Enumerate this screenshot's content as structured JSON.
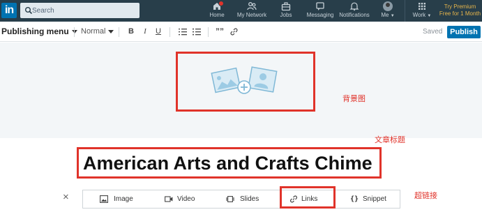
{
  "nav": {
    "logo": "in",
    "search_placeholder": "Search",
    "items": [
      {
        "label": "Home"
      },
      {
        "label": "My Network"
      },
      {
        "label": "Jobs"
      },
      {
        "label": "Messaging"
      },
      {
        "label": "Notifications"
      },
      {
        "label": "Me"
      },
      {
        "label": "Work"
      }
    ],
    "premium_line1": "Try Premium",
    "premium_line2": "Free for 1 Month"
  },
  "toolbar": {
    "publishing_menu": "Publishing menu",
    "style": "Normal",
    "bold": "B",
    "italic": "I",
    "underline": "U",
    "quote": "””",
    "saved": "Saved",
    "publish": "Publish"
  },
  "annotations": {
    "cover": "背景图",
    "title": "文章标题",
    "links": "超链接"
  },
  "article": {
    "title": "American Arts and Crafts Chime"
  },
  "media_bar": {
    "close": "×",
    "image": "Image",
    "video": "Video",
    "slides": "Slides",
    "links": "Links",
    "snippet": "Snippet",
    "snippet_icon": "{}"
  },
  "colors": {
    "nav_bg": "#283e4a",
    "brand_blue": "#0073b1",
    "annotation_red": "#e0332a",
    "premium_gold": "#e6b54a"
  }
}
